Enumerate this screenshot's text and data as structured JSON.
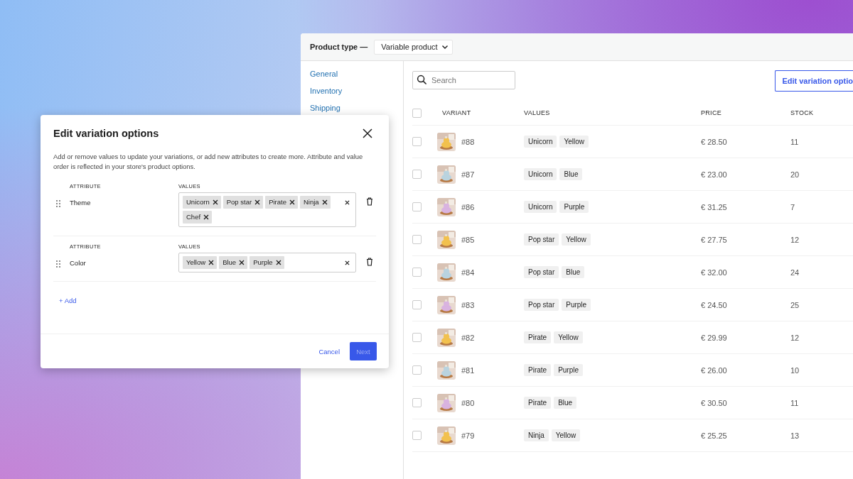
{
  "panel": {
    "product_type_label": "Product type —",
    "product_type": "Variable product"
  },
  "sidebar": {
    "items": [
      {
        "label": "General"
      },
      {
        "label": "Inventory"
      },
      {
        "label": "Shipping"
      }
    ]
  },
  "search": {
    "placeholder": "Search"
  },
  "edit_button": "Edit variation optio",
  "table": {
    "header_checked": false,
    "columns": [
      "VARIANT",
      "VALUES",
      "PRICE",
      "STOCK"
    ],
    "rows": [
      {
        "variant": "#88",
        "values": [
          "Unicorn",
          "Yellow"
        ],
        "price": "€ 28.50",
        "stock": "11",
        "checked": false
      },
      {
        "variant": "#87",
        "values": [
          "Unicorn",
          "Blue"
        ],
        "price": "€ 23.00",
        "stock": "20",
        "checked": false
      },
      {
        "variant": "#86",
        "values": [
          "Unicorn",
          "Purple"
        ],
        "price": "€ 31.25",
        "stock": "7",
        "checked": false
      },
      {
        "variant": "#85",
        "values": [
          "Pop star",
          "Yellow"
        ],
        "price": "€ 27.75",
        "stock": "12",
        "checked": false
      },
      {
        "variant": "#84",
        "values": [
          "Pop star",
          "Blue"
        ],
        "price": "€ 32.00",
        "stock": "24",
        "checked": false
      },
      {
        "variant": "#83",
        "values": [
          "Pop star",
          "Purple"
        ],
        "price": "€ 24.50",
        "stock": "25",
        "checked": false
      },
      {
        "variant": "#82",
        "values": [
          "Pirate",
          "Yellow"
        ],
        "price": "€ 29.99",
        "stock": "12",
        "checked": false
      },
      {
        "variant": "#81",
        "values": [
          "Pirate",
          "Purple"
        ],
        "price": "€ 26.00",
        "stock": "10",
        "checked": false
      },
      {
        "variant": "#80",
        "values": [
          "Pirate",
          "Blue"
        ],
        "price": "€ 30.50",
        "stock": "11",
        "checked": false
      },
      {
        "variant": "#79",
        "values": [
          "Ninja",
          "Yellow"
        ],
        "price": "€ 25.25",
        "stock": "13",
        "checked": false
      }
    ]
  },
  "dialog": {
    "title": "Edit variation options",
    "description": "Add or remove values to update your variations, or add new attributes to create more. Attribute and value order is reflected in your store's product options.",
    "attributes": [
      {
        "attribute_label": "ATTRIBUTE",
        "values_label": "VALUES",
        "name": "Theme",
        "values": [
          "Unicorn",
          "Pop star",
          "Pirate",
          "Ninja",
          "Chef"
        ]
      },
      {
        "attribute_label": "ATTRIBUTE",
        "values_label": "VALUES",
        "name": "Color",
        "values": [
          "Yellow",
          "Blue",
          "Purple"
        ]
      }
    ],
    "add_link": "+ Add",
    "cancel": "Cancel",
    "next": {
      "label": "Next",
      "disabled": true
    }
  }
}
